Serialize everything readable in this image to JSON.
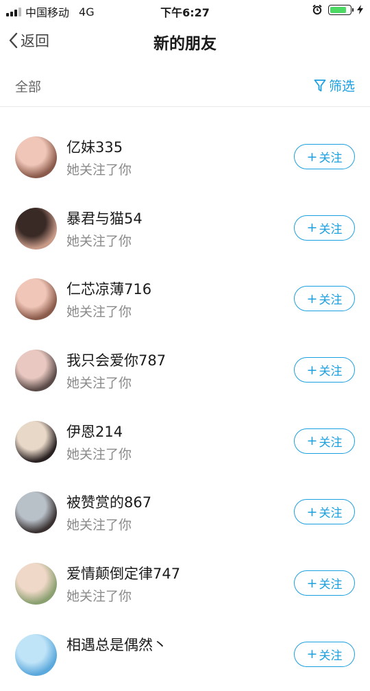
{
  "status_bar": {
    "carrier": "中国移动",
    "network": "4G",
    "time": "下午6:27",
    "battery_level": 0.85,
    "battery_color": "#4cd964"
  },
  "nav": {
    "back_label": "返回",
    "title": "新的朋友"
  },
  "filter_bar": {
    "all_label": "全部",
    "filter_label": "筛选"
  },
  "accent_color": "#1a9fe0",
  "friends": [
    {
      "name": "亿妹335",
      "subtitle": "她关注了你",
      "follow_label": "关注",
      "avatar_colors": [
        "#f0c6b8",
        "#8a5a4a"
      ]
    },
    {
      "name": "暴君与猫54",
      "subtitle": "她关注了你",
      "follow_label": "关注",
      "avatar_colors": [
        "#3a2a26",
        "#c89a88"
      ]
    },
    {
      "name": "仁芯凉薄716",
      "subtitle": "她关注了你",
      "follow_label": "关注",
      "avatar_colors": [
        "#f0c6b8",
        "#8a5a4a"
      ]
    },
    {
      "name": "我只会爱你787",
      "subtitle": "她关注了你",
      "follow_label": "关注",
      "avatar_colors": [
        "#e8c8c0",
        "#5a4a48"
      ]
    },
    {
      "name": "伊恩214",
      "subtitle": "她关注了你",
      "follow_label": "关注",
      "avatar_colors": [
        "#e8d8c8",
        "#2a2222"
      ]
    },
    {
      "name": "被赞赏的867",
      "subtitle": "她关注了你",
      "follow_label": "关注",
      "avatar_colors": [
        "#b8c0c8",
        "#3a3232"
      ]
    },
    {
      "name": "爱情颠倒定律747",
      "subtitle": "她关注了你",
      "follow_label": "关注",
      "avatar_colors": [
        "#f0d8c8",
        "#8aa070"
      ]
    },
    {
      "name": "相遇总是偶然丶",
      "subtitle": "",
      "follow_label": "关注",
      "avatar_colors": [
        "#bfe3f7",
        "#5aa8dc"
      ]
    }
  ]
}
